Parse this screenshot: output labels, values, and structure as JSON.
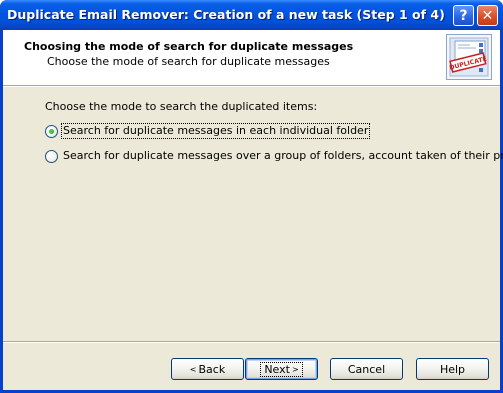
{
  "window": {
    "title": "Duplicate Email Remover: Creation of a new task (Step 1 of 4)",
    "help_glyph": "?",
    "close_glyph": "✕"
  },
  "header": {
    "title": "Choosing the mode of search for duplicate messages",
    "subtitle": "Choose the mode of search for duplicate messages",
    "icon_stamp_text": "DUPLICATE",
    "icon_name": "duplicate-stamp-icon"
  },
  "main": {
    "prompt": "Choose the mode to search the duplicated items:",
    "options": [
      {
        "label": "Search for duplicate messages in each individual folder",
        "selected": true
      },
      {
        "label": "Search for duplicate messages over a group of folders, account taken of their priority",
        "selected": false
      }
    ]
  },
  "buttons": {
    "back": {
      "label": "Back",
      "arrow": "<"
    },
    "next": {
      "label": "Next",
      "arrow": ">"
    },
    "cancel": {
      "label": "Cancel"
    },
    "help": {
      "label": "Help"
    }
  },
  "colors": {
    "titlebar": "#0054e3",
    "dialog_bg": "#ece9d8",
    "radio_dot": "#21a121",
    "button_border": "#003c74"
  }
}
